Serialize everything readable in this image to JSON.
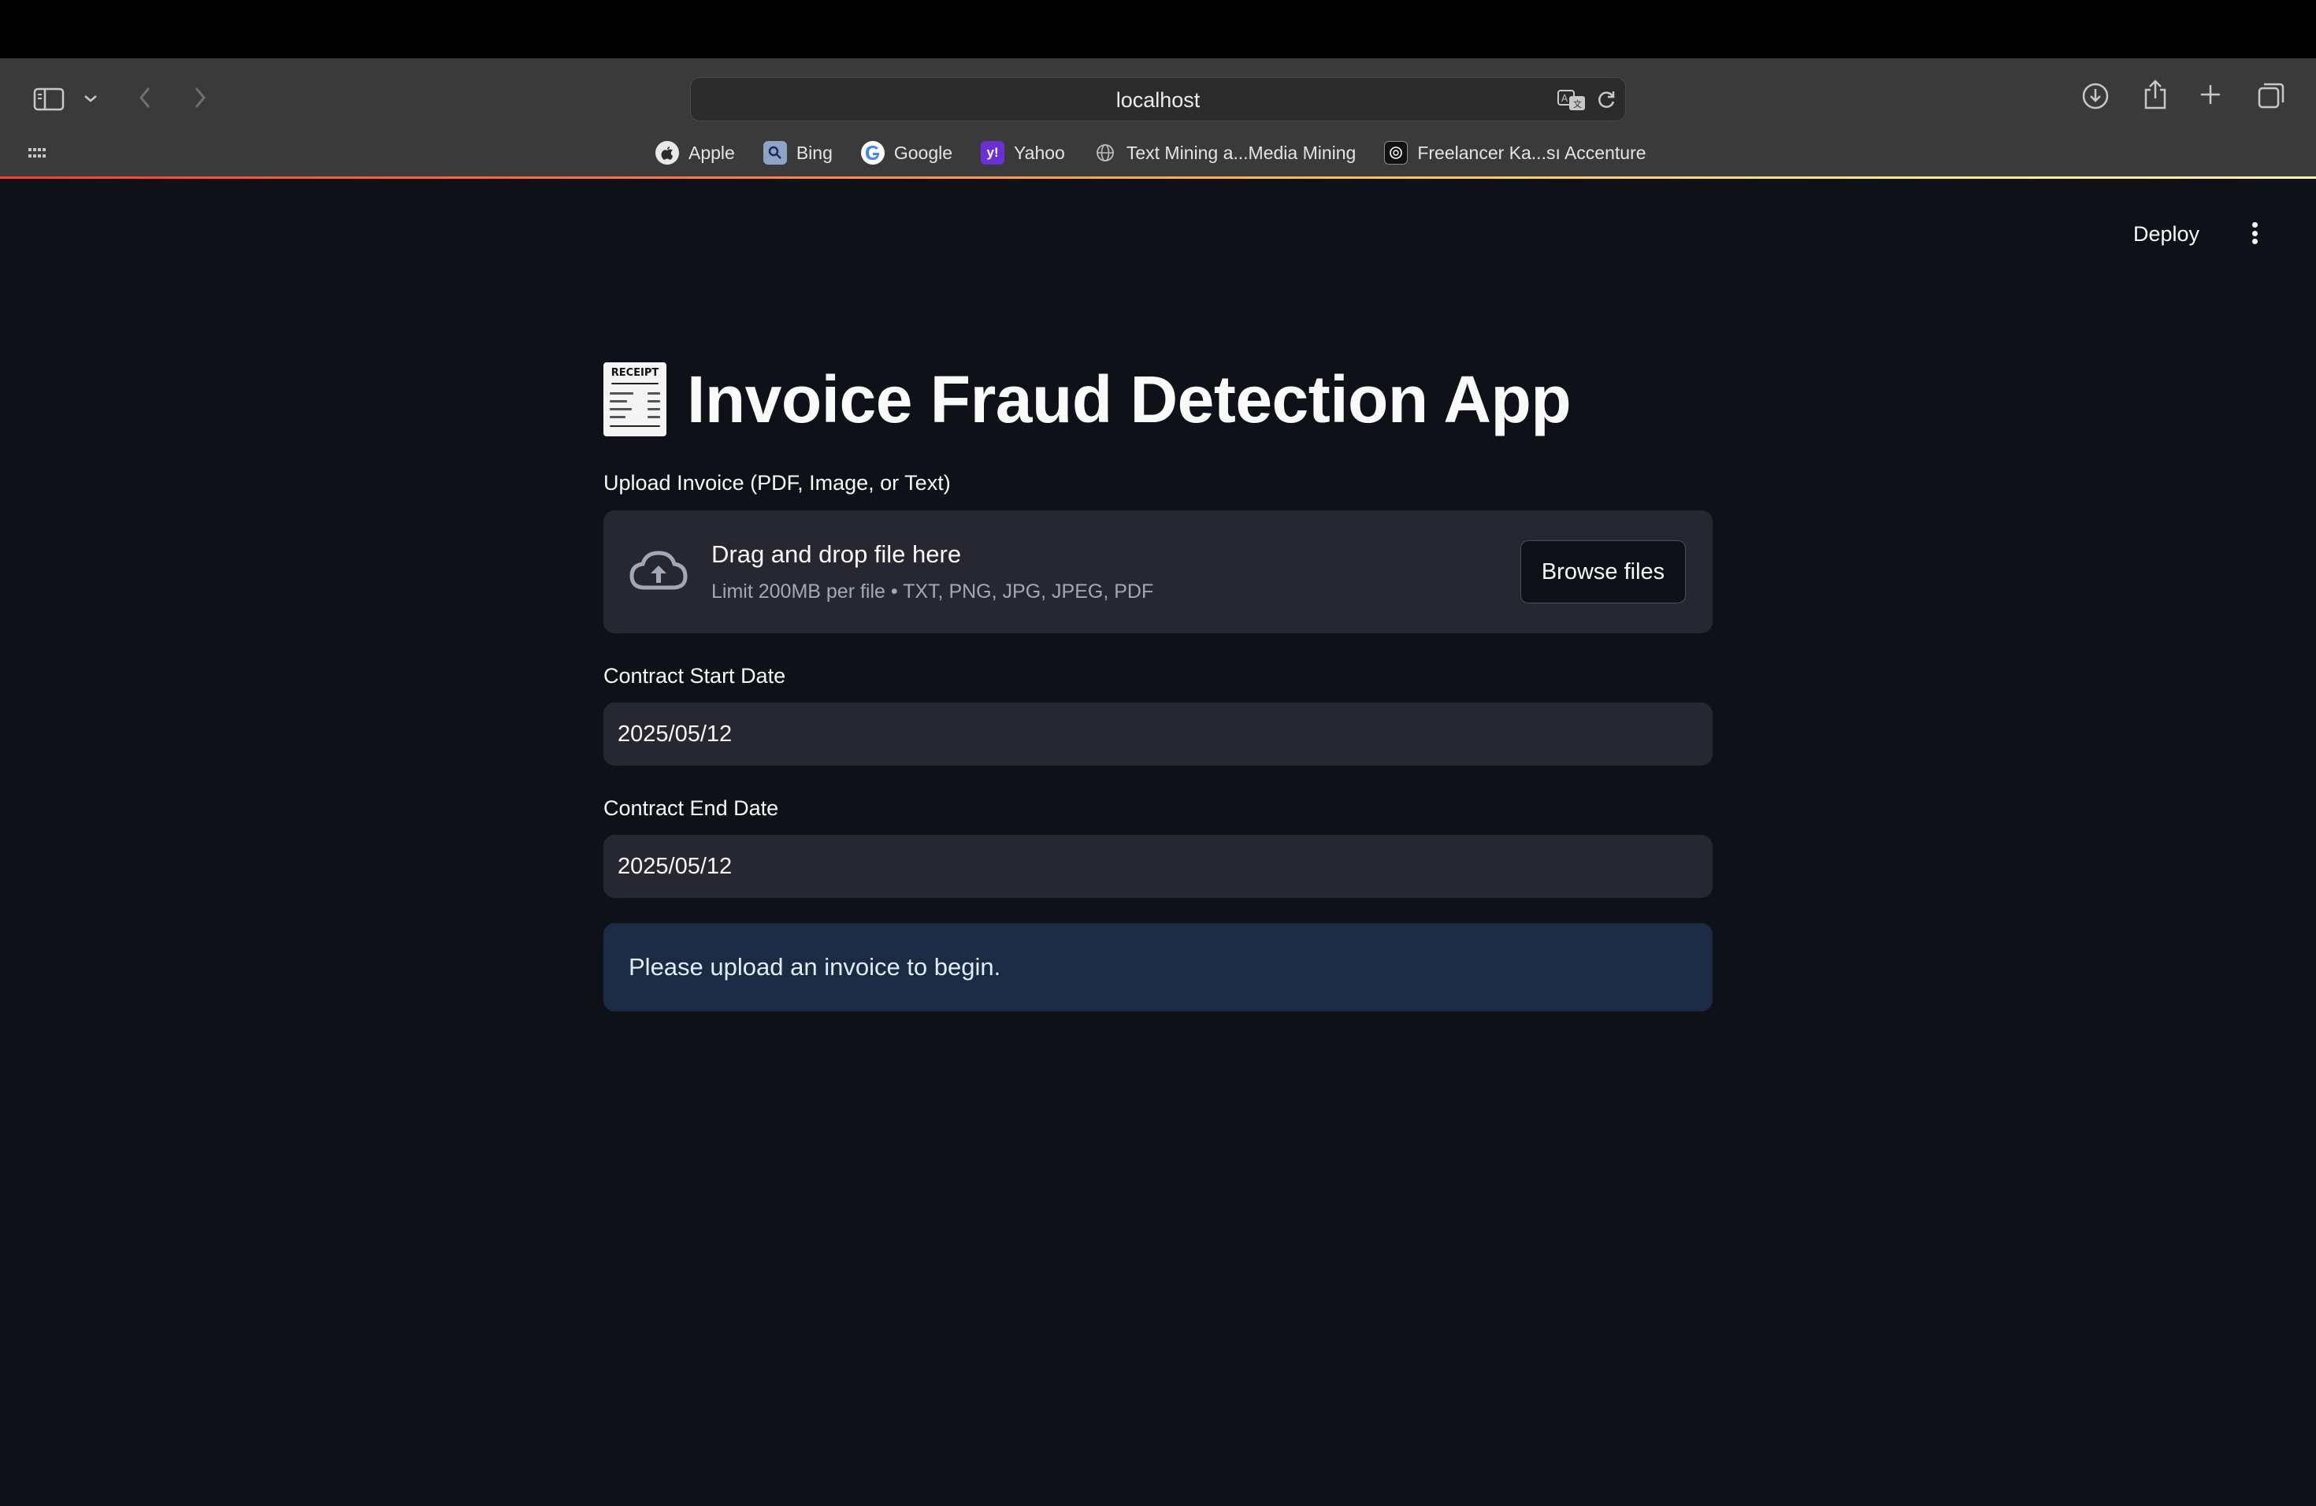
{
  "browser": {
    "url": "localhost",
    "bookmarks": [
      {
        "label": "Apple",
        "icon": "apple-icon"
      },
      {
        "label": "Bing",
        "icon": "bing-icon"
      },
      {
        "label": "Google",
        "icon": "google-icon"
      },
      {
        "label": "Yahoo",
        "icon": "yahoo-icon"
      },
      {
        "label": "Text Mining a...Media Mining",
        "icon": "globe-icon"
      },
      {
        "label": "Freelancer Ka...sı Accenture",
        "icon": "openai-icon"
      }
    ]
  },
  "header": {
    "deploy_label": "Deploy",
    "menu_icon": "more-vertical-icon"
  },
  "app": {
    "title_icon": "receipt-icon",
    "title": "Invoice Fraud Detection App",
    "uploader": {
      "label": "Upload Invoice (PDF, Image, or Text)",
      "drag_text": "Drag and drop file here",
      "limit_text": "Limit 200MB per file • TXT, PNG, JPG, JPEG, PDF",
      "browse_label": "Browse files",
      "icon": "cloud-upload-icon"
    },
    "start_date": {
      "label": "Contract Start Date",
      "value": "2025/05/12"
    },
    "end_date": {
      "label": "Contract End Date",
      "value": "2025/05/12"
    },
    "info_message": "Please upload an invoice to begin."
  },
  "colors": {
    "background": "#0e1117",
    "surface": "#262730",
    "info_background": "#1c2b44",
    "text": "#fafafa"
  }
}
